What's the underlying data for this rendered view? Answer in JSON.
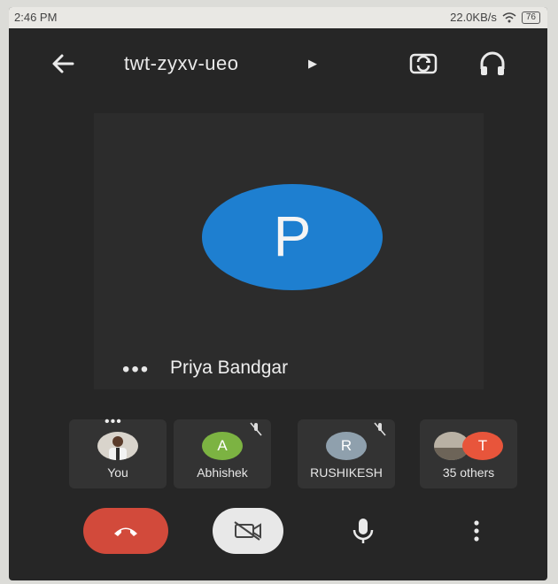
{
  "status_bar": {
    "time": "2:46 PM",
    "net_speed": "22.0KB/s",
    "battery": "76"
  },
  "top_bar": {
    "meeting_code": "twt-zyxv-ueo",
    "icons": [
      "back-arrow-icon",
      "caret-right-icon",
      "switch-camera-icon",
      "headphones-icon"
    ]
  },
  "main_tile": {
    "avatar_letter": "P",
    "avatar_color": "#1e7fd0",
    "more_label": "•••",
    "participant_name": "Priya Bandgar"
  },
  "participants": [
    {
      "name": "You",
      "avatar": "photo",
      "more": "•••"
    },
    {
      "name": "Abhishek",
      "avatar_letter": "A",
      "avatar_color": "#7cb342",
      "muted": true
    },
    {
      "name": "RUSHIKESH",
      "avatar_letter": "R",
      "avatar_color": "#8fa0ad",
      "muted": true
    },
    {
      "name": "35 others",
      "avatar_letter": "T",
      "avatar_color": "#e8553b"
    }
  ],
  "controls": {
    "end_call_color": "#d24a3b",
    "icons": [
      "end-call-icon",
      "camera-off-icon",
      "microphone-icon",
      "more-vertical-icon"
    ]
  }
}
